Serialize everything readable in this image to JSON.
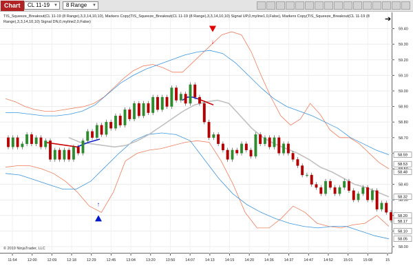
{
  "toolbar": {
    "chart_tab": "Chart",
    "instrument": "CL 11-19",
    "bar_type": "8 Range"
  },
  "indicator_label": "TIS_Squeeze_Breakout(CL 11-19 (8 Range),3,3,14,10,10), Markers Copy(TIS_Squeeze_Breakout(CL 11-19 (8 Range),3,3,14,10,10) Signal UP,0,myline1,0,False), Markers Copy(TIS_Squeeze_Breakout(CL 11-19 (8 Range),3,3,14,10,10) Signal DN,0,myline2,0,False)",
  "copyright": "© 2019 NinjaTrader, LLC",
  "price_axis": {
    "ticks": [
      "59.40",
      "59.30",
      "59.20",
      "59.10",
      "59.00",
      "58.90",
      "58.80",
      "58.70",
      "58.60",
      "58.50",
      "58.40",
      "58.30",
      "58.20",
      "58.10",
      "58.00"
    ],
    "markers": [
      {
        "label": "58.59",
        "price": 58.59
      },
      {
        "label": "58.53",
        "price": 58.53
      },
      {
        "label": "58.48",
        "price": 58.48
      },
      {
        "label": "58.32",
        "price": 58.32
      },
      {
        "label": "58.20",
        "price": 58.2
      },
      {
        "label": "58.17",
        "price": 58.17
      },
      {
        "label": "58.10",
        "price": 58.1
      },
      {
        "label": "58.05",
        "price": 58.05
      }
    ]
  },
  "time_axis": {
    "labels": [
      "11:54",
      "12:00",
      "12:09",
      "12:18",
      "12:29",
      "12:45",
      "13:04",
      "13:20",
      "13:50",
      "14:07",
      "14:13",
      "14:15",
      "14:20",
      "14:36",
      "14:37",
      "14:47",
      "14:52",
      "15:01",
      "15:08",
      "15"
    ]
  },
  "colors": {
    "up_candle": "#2e8b2e",
    "down_candle": "#b30000",
    "outer_band": "#f07c5a",
    "inner_band": "#3a95e0",
    "midline": "#c0c0c0",
    "squeeze_red": "#cc0000",
    "squeeze_blue": "#1020d0",
    "signal_up": "#0018c8",
    "signal_down": "#e00000"
  },
  "chart_data": {
    "type": "candlestick",
    "instrument": "CL 11-19",
    "bar_type": "8 Range",
    "ylim": [
      58.0,
      59.46
    ],
    "series_open": [
      58.7,
      58.64,
      58.7,
      58.64,
      58.66,
      58.72,
      58.66,
      58.7,
      58.64,
      58.68,
      58.56,
      58.62,
      58.56,
      58.62,
      58.56,
      58.64,
      58.6,
      58.68,
      58.74,
      58.7,
      58.78,
      58.72,
      58.8,
      58.76,
      58.84,
      58.78,
      58.88,
      58.82,
      58.92,
      58.84,
      58.92,
      58.86,
      58.96,
      58.88,
      58.96,
      58.9,
      59.02,
      58.94,
      58.98,
      58.92,
      59.04,
      58.96,
      58.92,
      58.8,
      58.7,
      58.72,
      58.66,
      58.62,
      58.56,
      58.62,
      58.6,
      58.66,
      58.62,
      58.58,
      58.72,
      58.66,
      58.7,
      58.64,
      58.7,
      58.6,
      58.66,
      58.6,
      58.56,
      58.52,
      58.46,
      58.46,
      58.4,
      58.38,
      58.34,
      58.42,
      58.38,
      58.34,
      58.38,
      58.42,
      58.36,
      58.3,
      58.34,
      58.38,
      58.3,
      58.36,
      58.24,
      58.28,
      58.22
    ],
    "series_close": [
      58.64,
      58.7,
      58.64,
      58.66,
      58.72,
      58.66,
      58.7,
      58.64,
      58.68,
      58.56,
      58.62,
      58.56,
      58.62,
      58.56,
      58.64,
      58.6,
      58.68,
      58.74,
      58.7,
      58.78,
      58.72,
      58.8,
      58.76,
      58.84,
      58.78,
      58.88,
      58.82,
      58.92,
      58.84,
      58.92,
      58.86,
      58.96,
      58.88,
      58.96,
      58.9,
      59.02,
      58.94,
      58.98,
      58.92,
      59.04,
      58.96,
      58.92,
      58.8,
      58.7,
      58.72,
      58.66,
      58.62,
      58.56,
      58.62,
      58.6,
      58.66,
      58.62,
      58.58,
      58.72,
      58.66,
      58.7,
      58.64,
      58.7,
      58.6,
      58.66,
      58.6,
      58.56,
      58.52,
      58.46,
      58.46,
      58.4,
      58.38,
      58.34,
      58.42,
      58.38,
      58.34,
      58.38,
      58.42,
      58.36,
      58.3,
      58.34,
      58.38,
      58.3,
      58.36,
      58.24,
      58.28,
      58.22,
      58.17
    ],
    "upper_outer": [
      58.95,
      58.93,
      58.9,
      58.88,
      58.87,
      58.87,
      58.88,
      58.89,
      58.9,
      58.92,
      58.96,
      59.02,
      59.08,
      59.13,
      59.16,
      59.17,
      59.15,
      59.12,
      59.12,
      59.18,
      59.24,
      59.3,
      59.36,
      59.38,
      59.36,
      59.25,
      59.1,
      58.96,
      58.84,
      58.78,
      58.82,
      58.92,
      58.85,
      58.75,
      58.7,
      58.7,
      58.66,
      58.6,
      58.54,
      58.5
    ],
    "upper_inner": [
      58.86,
      58.86,
      58.85,
      58.84,
      58.84,
      58.85,
      58.87,
      58.91,
      58.98,
      59.05,
      59.1,
      59.14,
      59.17,
      59.2,
      59.23,
      59.25,
      59.26,
      59.24,
      59.18,
      59.1,
      59.02,
      58.95,
      58.9,
      58.87,
      58.84,
      58.8,
      58.76,
      58.7,
      58.66,
      58.62,
      58.59
    ],
    "mid": [
      58.7,
      58.67,
      58.66,
      58.65,
      58.64,
      58.65,
      58.68,
      58.72,
      58.77,
      58.82,
      58.87,
      58.91,
      58.93,
      58.94,
      58.92,
      58.84,
      58.76,
      58.7,
      58.66,
      58.63,
      58.6,
      58.56,
      58.51,
      58.48,
      58.44,
      58.4,
      58.38,
      58.35,
      58.32
    ],
    "lower_inner": [
      58.47,
      58.46,
      58.43,
      58.4,
      58.37,
      58.37,
      58.42,
      58.51,
      58.6,
      58.68,
      58.72,
      58.73,
      58.72,
      58.68,
      58.56,
      58.44,
      58.34,
      58.27,
      58.22,
      58.18,
      58.15,
      58.13,
      58.12,
      58.13,
      58.13,
      58.1,
      58.07,
      58.05
    ],
    "lower_outer": [
      58.51,
      58.52,
      58.52,
      58.5,
      58.47,
      58.42,
      58.35,
      58.26,
      58.22,
      58.35,
      58.55,
      58.6,
      58.62,
      58.63,
      58.65,
      58.67,
      58.68,
      58.67,
      58.55,
      58.4,
      58.22,
      58.12,
      58.12,
      58.18,
      58.26,
      58.22,
      58.15,
      58.13,
      58.12,
      58.14,
      58.15,
      58.2,
      58.13
    ],
    "squeeze_red": [
      58.67,
      58.66,
      58.65,
      58.64
    ],
    "squeeze_blue_1": [
      58.64,
      58.67,
      58.69
    ],
    "squeeze_blue_2": [
      58.94,
      58.96,
      58.96,
      58.95
    ],
    "squeeze_red_2": [
      58.95,
      58.93,
      58.91
    ],
    "signals": [
      {
        "type": "up",
        "price": 58.18
      },
      {
        "type": "down",
        "price": 59.4
      }
    ]
  }
}
